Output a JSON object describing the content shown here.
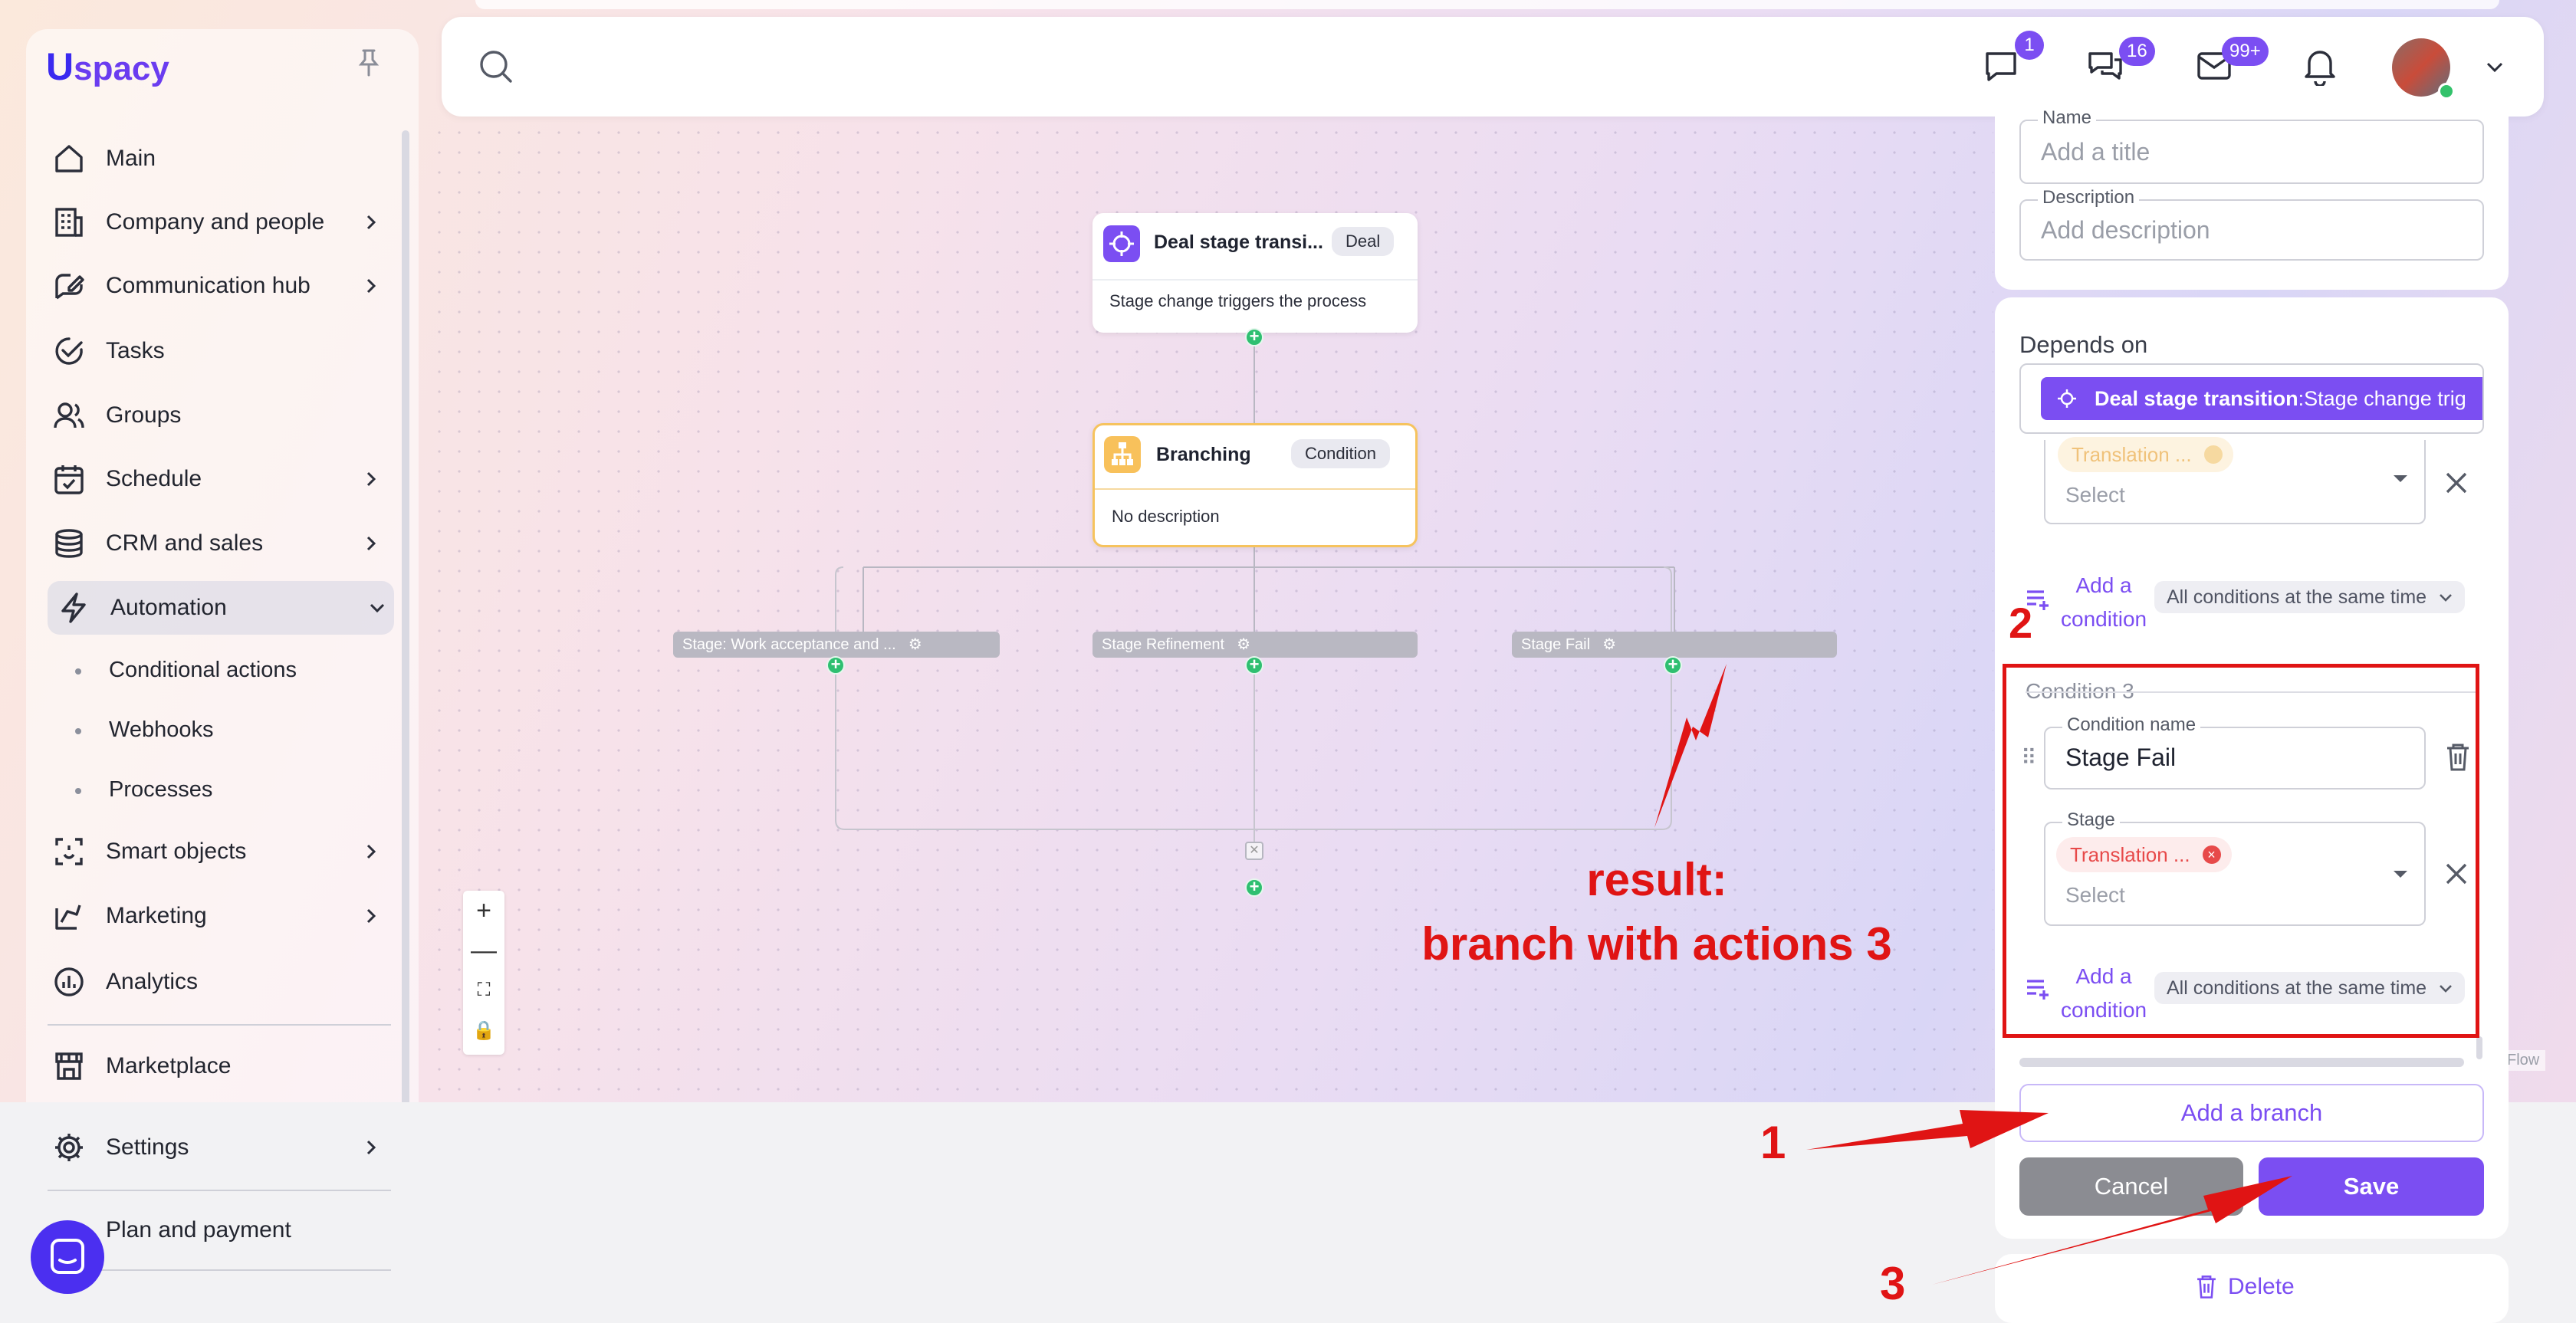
{
  "app": {
    "logo_text": "spacy",
    "logo_initial": "U"
  },
  "sidebar": {
    "items": [
      {
        "label": "Main",
        "icon": "home-icon"
      },
      {
        "label": "Company and people",
        "icon": "building-icon"
      },
      {
        "label": "Communication hub",
        "icon": "pen-chat-icon"
      },
      {
        "label": "Tasks",
        "icon": "check-circle-icon"
      },
      {
        "label": "Groups",
        "icon": "users-icon"
      },
      {
        "label": "Schedule",
        "icon": "calendar-icon"
      },
      {
        "label": "CRM and sales",
        "icon": "coins-icon"
      },
      {
        "label": "Automation",
        "icon": "bolt-icon"
      }
    ],
    "automation_sub": [
      {
        "label": "Conditional actions"
      },
      {
        "label": "Webhooks"
      },
      {
        "label": "Processes"
      }
    ],
    "items2": [
      {
        "label": "Smart objects",
        "icon": "scan-face-icon"
      },
      {
        "label": "Marketing",
        "icon": "megaphone-icon"
      },
      {
        "label": "Analytics",
        "icon": "chart-icon"
      }
    ],
    "marketplace": "Marketplace",
    "settings": "Settings",
    "plan": "Plan and payment"
  },
  "topbar": {
    "badges": {
      "chat": "1",
      "comments": "16",
      "mail": "99+"
    }
  },
  "canvas": {
    "trigger": {
      "title": "Deal stage transi...",
      "chip": "Deal",
      "desc": "Stage change triggers the process"
    },
    "branching": {
      "title": "Branching",
      "chip": "Condition",
      "desc": "No description"
    },
    "branches": [
      {
        "label": "Stage: Work acceptance and ..."
      },
      {
        "label": "Stage Refinement"
      },
      {
        "label": "Stage Fail"
      }
    ],
    "watermark": "Flow"
  },
  "panel": {
    "name": {
      "label": "Name",
      "placeholder": "Add a title"
    },
    "description": {
      "label": "Description",
      "placeholder": "Add description"
    },
    "depends_on": "Depends on",
    "dep_chip": {
      "bold": "Deal stage transition",
      "rest": ":Stage change trig"
    },
    "cond_upper": {
      "tag": "Translation ...",
      "select": "Select",
      "add_line1": "Add a",
      "add_line2": "condition",
      "mode": "All conditions at the same time"
    },
    "cond3": {
      "heading": "Condition 3",
      "name_label": "Condition name",
      "name_value": "Stage Fail",
      "stage_label": "Stage",
      "tag": "Translation ...",
      "select": "Select",
      "add_line1": "Add a",
      "add_line2": "condition",
      "mode": "All conditions at the same time"
    },
    "add_branch": "Add a branch",
    "cancel": "Cancel",
    "save": "Save",
    "delete": "Delete"
  },
  "annotations": {
    "result_line1": "result:",
    "result_line2": "branch with actions 3",
    "n1": "1",
    "n2": "2",
    "n3": "3",
    "color": "#e01414"
  }
}
